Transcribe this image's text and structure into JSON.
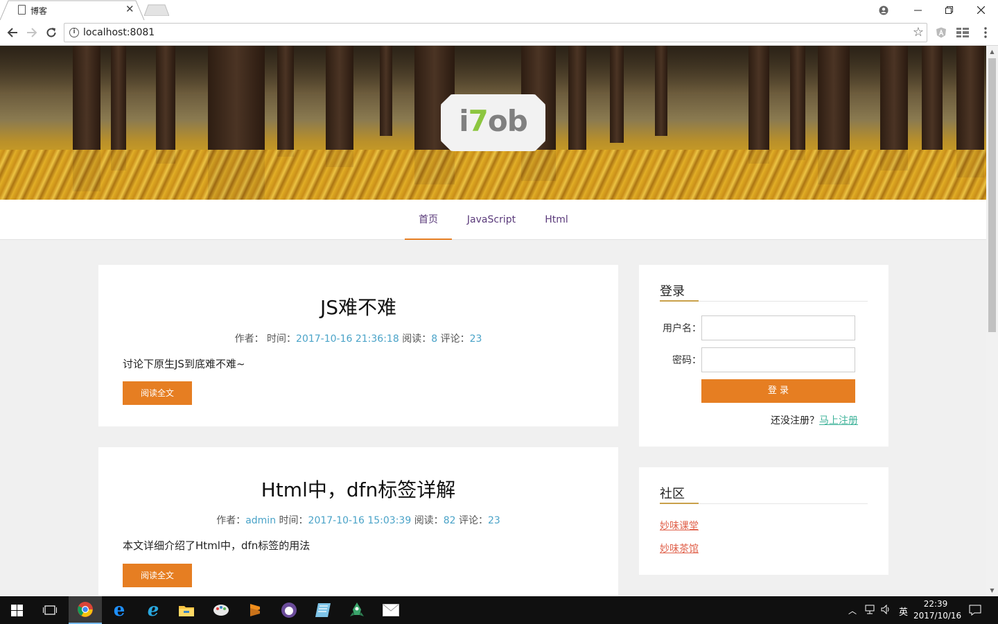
{
  "browser": {
    "tab_title": "博客",
    "url": "localhost:8081",
    "icons": [
      "back-icon",
      "forward-icon",
      "reload-icon",
      "info-icon",
      "star-icon",
      "account-icon",
      "minimize-icon",
      "maximize-icon",
      "close-icon"
    ]
  },
  "site": {
    "logo_text_a": "i",
    "logo_text_b": "7",
    "logo_text_c": "ob",
    "nav": [
      {
        "label": "首页",
        "active": true
      },
      {
        "label": "JavaScript",
        "active": false
      },
      {
        "label": "Html",
        "active": false
      }
    ]
  },
  "posts": [
    {
      "title": "JS难不难",
      "author_label": "作者：",
      "author": "",
      "time_label": "时间：",
      "time": "2017-10-16 21:36:18",
      "read_label": "阅读：",
      "reads": "8",
      "comment_label": "评论：",
      "comments": "23",
      "summary": "讨论下原生JS到底难不难~",
      "button": "阅读全文"
    },
    {
      "title": "Html中，dfn标签详解",
      "author_label": "作者：",
      "author": "admin",
      "time_label": "时间：",
      "time": "2017-10-16 15:03:39",
      "read_label": "阅读：",
      "reads": "82",
      "comment_label": "评论：",
      "comments": "23",
      "summary": "本文详细介绍了Html中，dfn标签的用法",
      "button": "阅读全文"
    }
  ],
  "login": {
    "title": "登录",
    "username_label": "用户名：",
    "username_value": "",
    "password_label": "密码：",
    "password_value": "",
    "submit": "登 录",
    "register_prompt": "还没注册？",
    "register_link": "马上注册"
  },
  "community": {
    "title": "社区",
    "links": [
      "妙味课堂",
      "妙味茶馆"
    ]
  },
  "taskbar": {
    "ime": "英",
    "time": "22:39",
    "date": "2017/10/16"
  },
  "colors": {
    "accent": "#e67e22",
    "link_blue": "#4aa3c8",
    "link_green": "#3fb39a",
    "link_red": "#e0604a"
  }
}
